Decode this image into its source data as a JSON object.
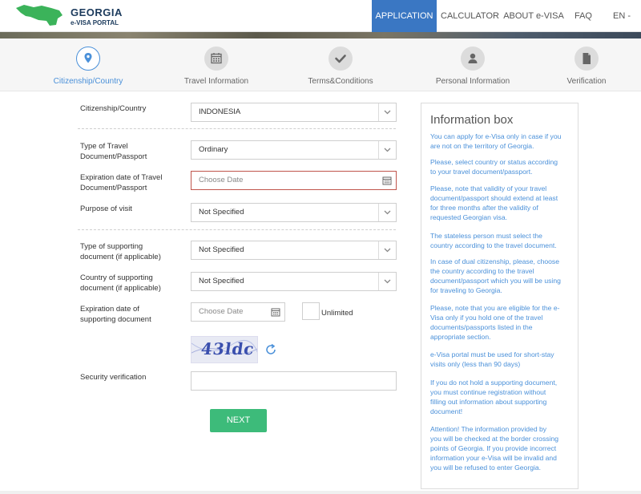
{
  "header": {
    "logo_line1": "GEORGIA",
    "logo_line2": "e-VISA PORTAL",
    "nav": [
      "APPLICATION",
      "CALCULATOR",
      "ABOUT e-VISA",
      "FAQ",
      "EN -"
    ]
  },
  "steps": [
    {
      "label": "Citizenship/Country",
      "icon": "location-pin-icon",
      "active": true
    },
    {
      "label": "Travel Information",
      "icon": "calendar-icon",
      "active": false
    },
    {
      "label": "Terms&Conditions",
      "icon": "checkmark-icon",
      "active": false
    },
    {
      "label": "Personal Information",
      "icon": "person-icon",
      "active": false
    },
    {
      "label": "Verification",
      "icon": "document-icon",
      "active": false
    }
  ],
  "form": {
    "citizenship": {
      "label": "Citizenship/Country",
      "value": "INDONESIA"
    },
    "doc_type": {
      "label_line1": "Type of Travel",
      "label_line2": "Document/Passport",
      "value": "Ordinary"
    },
    "doc_expiration": {
      "label_line1": "Expiration date of Travel",
      "label_line2": "Document/Passport",
      "placeholder": "Choose Date"
    },
    "purpose": {
      "label": "Purpose of visit",
      "value": "Not Specified"
    },
    "support_type": {
      "label_line1": "Type of supporting",
      "label_line2": "document (if applicable)",
      "value": "Not Specified"
    },
    "support_country": {
      "label_line1": "Country of supporting",
      "label_line2": "document (if applicable)",
      "value": "Not Specified"
    },
    "support_expiration": {
      "label_line1": "Expiration date of",
      "label_line2": "supporting document",
      "placeholder": "Choose Date",
      "unlimited_label": "Unlimited"
    },
    "captcha_text": "43ldc",
    "security": {
      "label": "Security verification",
      "value": ""
    },
    "next_label": "NEXT"
  },
  "info": {
    "title": "Information box",
    "paragraphs": [
      [
        "You can apply for e-Visa only in case if you",
        "are not on the territory of Georgia."
      ],
      [
        "Please, select country or status according",
        "to your travel document/passport."
      ],
      [
        "Please, note that validity of your travel",
        "document/passport should extend at least",
        "for three months after the validity of",
        "requested Georgian visa."
      ],
      [
        "The stateless person must select the",
        "country according to the travel document."
      ],
      [
        "In case of dual citizenship, please, choose",
        "the country according to the travel",
        "document/passport which you will be using",
        "for traveling to Georgia."
      ],
      [
        "Please, note that you are eligible for the e-",
        "Visa only if you hold one of the travel",
        "documents/passports listed in the",
        "appropriate section."
      ],
      [
        "e-Visa portal must be used for short-stay",
        "visits only (less than 90 days)"
      ],
      [
        "If you do not hold a supporting document,",
        "you must continue registration without",
        "filling out information about supporting",
        "document!"
      ],
      [
        "Attention! The information provided by",
        "you will be checked at the border crossing",
        "points of Georgia. If you provide incorrect",
        "information your e-Visa will be invalid and",
        "you will be refused to enter Georgia."
      ]
    ]
  },
  "colors": {
    "accent": "#3a77c3",
    "info_text": "#4a90d9",
    "next_button": "#3dbb7a",
    "error_border": "#c0554c"
  }
}
